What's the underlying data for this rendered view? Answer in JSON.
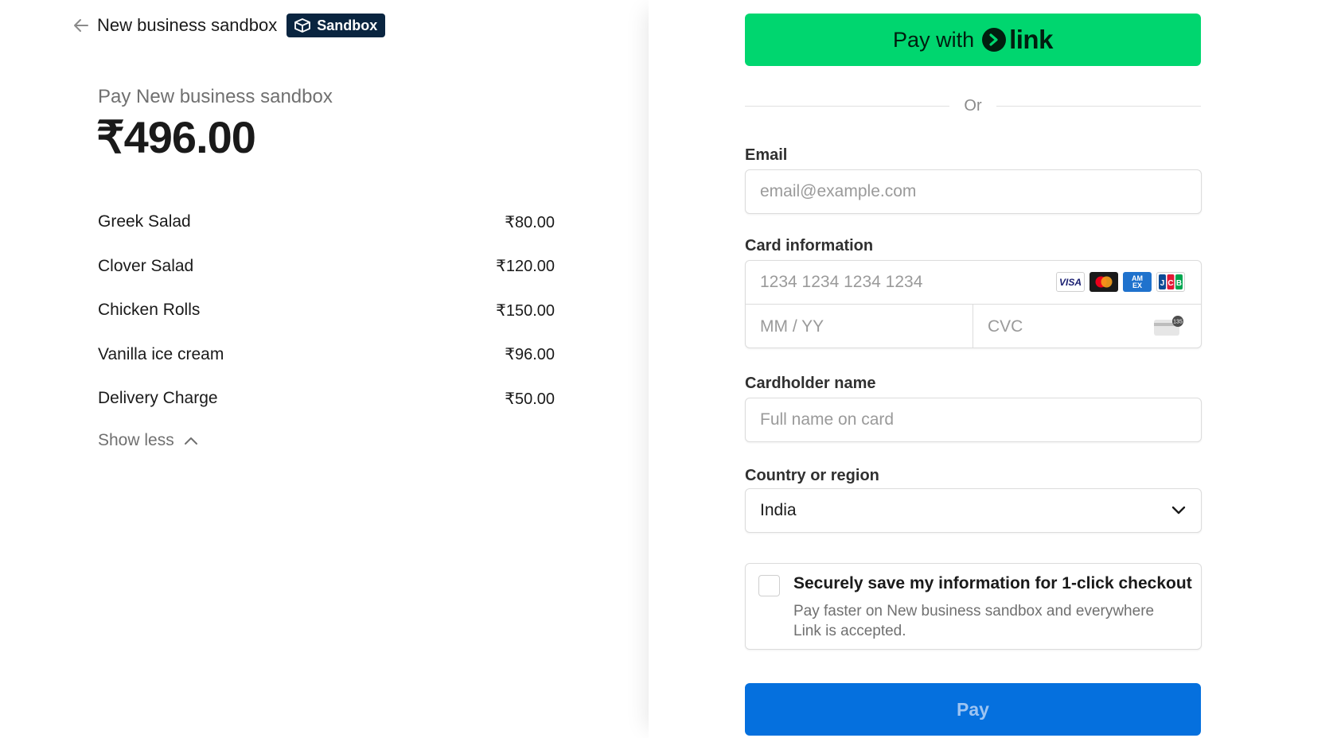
{
  "header": {
    "business_name": "New business sandbox",
    "badge_label": "Sandbox"
  },
  "summary": {
    "pay_title": "Pay New business sandbox",
    "total": "₹496.00",
    "items": [
      {
        "name": "Greek Salad",
        "price": "₹80.00"
      },
      {
        "name": "Clover Salad",
        "price": "₹120.00"
      },
      {
        "name": "Chicken Rolls",
        "price": "₹150.00"
      },
      {
        "name": "Vanilla ice cream",
        "price": "₹96.00"
      },
      {
        "name": "Delivery Charge",
        "price": "₹50.00"
      }
    ],
    "show_less_label": "Show less"
  },
  "link_button": {
    "pay_with": "Pay with",
    "brand": "link"
  },
  "divider_label": "Or",
  "email": {
    "label": "Email",
    "placeholder": "email@example.com",
    "value": ""
  },
  "card": {
    "label": "Card information",
    "number_placeholder": "1234 1234 1234 1234",
    "expiry_placeholder": "MM / YY",
    "cvc_placeholder": "CVC",
    "brands": [
      "VISA",
      "Mastercard",
      "AMEX",
      "JCB"
    ],
    "cvc_hint_number": "135"
  },
  "cardholder": {
    "label": "Cardholder name",
    "placeholder": "Full name on card"
  },
  "country": {
    "label": "Country or region",
    "selected": "India"
  },
  "save_info": {
    "title": "Securely save my information for 1-click checkout",
    "description": "Pay faster on New business sandbox and everywhere Link is accepted.",
    "checked": false
  },
  "pay_button_label": "Pay",
  "colors": {
    "link_green": "#00d66f",
    "pay_blue": "#0570de",
    "badge_navy": "#0a2540"
  }
}
